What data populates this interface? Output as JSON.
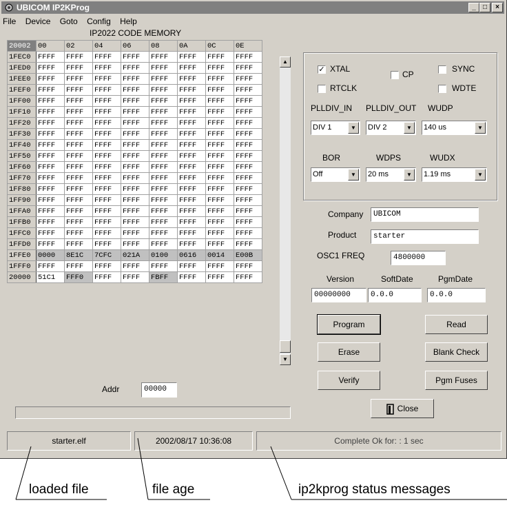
{
  "window": {
    "title": "UBICOM IP2KProg",
    "minimize": "_",
    "maximize": "□",
    "close": "×"
  },
  "menu": [
    "File",
    "Device",
    "Goto",
    "Config",
    "Help"
  ],
  "grid": {
    "title": "IP2022 CODE MEMORY",
    "corner": "20002",
    "columns": [
      "00",
      "02",
      "04",
      "06",
      "08",
      "0A",
      "0C",
      "0E"
    ],
    "rows": [
      {
        "addr": "1FEC0",
        "cells": [
          "FFFF",
          "FFFF",
          "FFFF",
          "FFFF",
          "FFFF",
          "FFFF",
          "FFFF",
          "FFFF"
        ]
      },
      {
        "addr": "1FED0",
        "cells": [
          "FFFF",
          "FFFF",
          "FFFF",
          "FFFF",
          "FFFF",
          "FFFF",
          "FFFF",
          "FFFF"
        ]
      },
      {
        "addr": "1FEE0",
        "cells": [
          "FFFF",
          "FFFF",
          "FFFF",
          "FFFF",
          "FFFF",
          "FFFF",
          "FFFF",
          "FFFF"
        ]
      },
      {
        "addr": "1FEF0",
        "cells": [
          "FFFF",
          "FFFF",
          "FFFF",
          "FFFF",
          "FFFF",
          "FFFF",
          "FFFF",
          "FFFF"
        ]
      },
      {
        "addr": "1FF00",
        "cells": [
          "FFFF",
          "FFFF",
          "FFFF",
          "FFFF",
          "FFFF",
          "FFFF",
          "FFFF",
          "FFFF"
        ]
      },
      {
        "addr": "1FF10",
        "cells": [
          "FFFF",
          "FFFF",
          "FFFF",
          "FFFF",
          "FFFF",
          "FFFF",
          "FFFF",
          "FFFF"
        ]
      },
      {
        "addr": "1FF20",
        "cells": [
          "FFFF",
          "FFFF",
          "FFFF",
          "FFFF",
          "FFFF",
          "FFFF",
          "FFFF",
          "FFFF"
        ]
      },
      {
        "addr": "1FF30",
        "cells": [
          "FFFF",
          "FFFF",
          "FFFF",
          "FFFF",
          "FFFF",
          "FFFF",
          "FFFF",
          "FFFF"
        ]
      },
      {
        "addr": "1FF40",
        "cells": [
          "FFFF",
          "FFFF",
          "FFFF",
          "FFFF",
          "FFFF",
          "FFFF",
          "FFFF",
          "FFFF"
        ]
      },
      {
        "addr": "1FF50",
        "cells": [
          "FFFF",
          "FFFF",
          "FFFF",
          "FFFF",
          "FFFF",
          "FFFF",
          "FFFF",
          "FFFF"
        ]
      },
      {
        "addr": "1FF60",
        "cells": [
          "FFFF",
          "FFFF",
          "FFFF",
          "FFFF",
          "FFFF",
          "FFFF",
          "FFFF",
          "FFFF"
        ]
      },
      {
        "addr": "1FF70",
        "cells": [
          "FFFF",
          "FFFF",
          "FFFF",
          "FFFF",
          "FFFF",
          "FFFF",
          "FFFF",
          "FFFF"
        ]
      },
      {
        "addr": "1FF80",
        "cells": [
          "FFFF",
          "FFFF",
          "FFFF",
          "FFFF",
          "FFFF",
          "FFFF",
          "FFFF",
          "FFFF"
        ]
      },
      {
        "addr": "1FF90",
        "cells": [
          "FFFF",
          "FFFF",
          "FFFF",
          "FFFF",
          "FFFF",
          "FFFF",
          "FFFF",
          "FFFF"
        ]
      },
      {
        "addr": "1FFA0",
        "cells": [
          "FFFF",
          "FFFF",
          "FFFF",
          "FFFF",
          "FFFF",
          "FFFF",
          "FFFF",
          "FFFF"
        ]
      },
      {
        "addr": "1FFB0",
        "cells": [
          "FFFF",
          "FFFF",
          "FFFF",
          "FFFF",
          "FFFF",
          "FFFF",
          "FFFF",
          "FFFF"
        ]
      },
      {
        "addr": "1FFC0",
        "cells": [
          "FFFF",
          "FFFF",
          "FFFF",
          "FFFF",
          "FFFF",
          "FFFF",
          "FFFF",
          "FFFF"
        ]
      },
      {
        "addr": "1FFD0",
        "cells": [
          "FFFF",
          "FFFF",
          "FFFF",
          "FFFF",
          "FFFF",
          "FFFF",
          "FFFF",
          "FFFF"
        ]
      },
      {
        "addr": "1FFE0",
        "cells": [
          "0000",
          "8E1C",
          "7CFC",
          "021A",
          "0100",
          "0616",
          "0014",
          "E00B"
        ]
      },
      {
        "addr": "1FFF0",
        "cells": [
          "FFFF",
          "FFFF",
          "FFFF",
          "FFFF",
          "FFFF",
          "FFFF",
          "FFFF",
          "FFFF"
        ]
      },
      {
        "addr": "20000",
        "cells": [
          "51C1",
          "FFF0",
          "FFFF",
          "FFFF",
          "FBFF",
          "FFFF",
          "FFFF",
          "FFFF"
        ]
      }
    ]
  },
  "addr": {
    "label": "Addr",
    "value": "00000"
  },
  "fuses": {
    "xtal": {
      "label": "XTAL",
      "checked": "✓"
    },
    "cp": {
      "label": "CP"
    },
    "sync": {
      "label": "SYNC"
    },
    "rtclk": {
      "label": "RTCLK"
    },
    "wdte": {
      "label": "WDTE"
    },
    "pllin_label": "PLLDIV_IN",
    "pllout_label": "PLLDIV_OUT",
    "wudp_label": "WUDP",
    "pllin_value": "DIV 1",
    "pllout_value": "DIV 2",
    "wudp_value": "140 us",
    "bor_label": "BOR",
    "wdps_label": "WDPS",
    "wudx_label": "WUDX",
    "bor_value": "Off",
    "wdps_value": "20 ms",
    "wudx_value": "1.19 ms"
  },
  "info": {
    "company_label": "Company",
    "company_value": "UBICOM",
    "product_label": "Product",
    "product_value": "starter",
    "osc_label": "OSC1 FREQ",
    "osc_value": "4800000",
    "version_label": "Version",
    "softdate_label": "SoftDate",
    "pgmdate_label": "PgmDate",
    "version_value": "00000000",
    "softdate_value": "0.0.0",
    "pgmdate_value": "0.0.0"
  },
  "buttons": {
    "program": "Program",
    "read": "Read",
    "erase": "Erase",
    "blank_check": "Blank Check",
    "verify": "Verify",
    "pgm_fuses": "Pgm Fuses",
    "close": "Close"
  },
  "status": {
    "file": "starter.elf",
    "age": "2002/08/17 10:36:08",
    "message": "Complete Ok  for:  : 1 sec"
  },
  "annotations": {
    "loaded_file": "loaded file",
    "file_age": "file age",
    "messages": "ip2kprog status messages"
  }
}
